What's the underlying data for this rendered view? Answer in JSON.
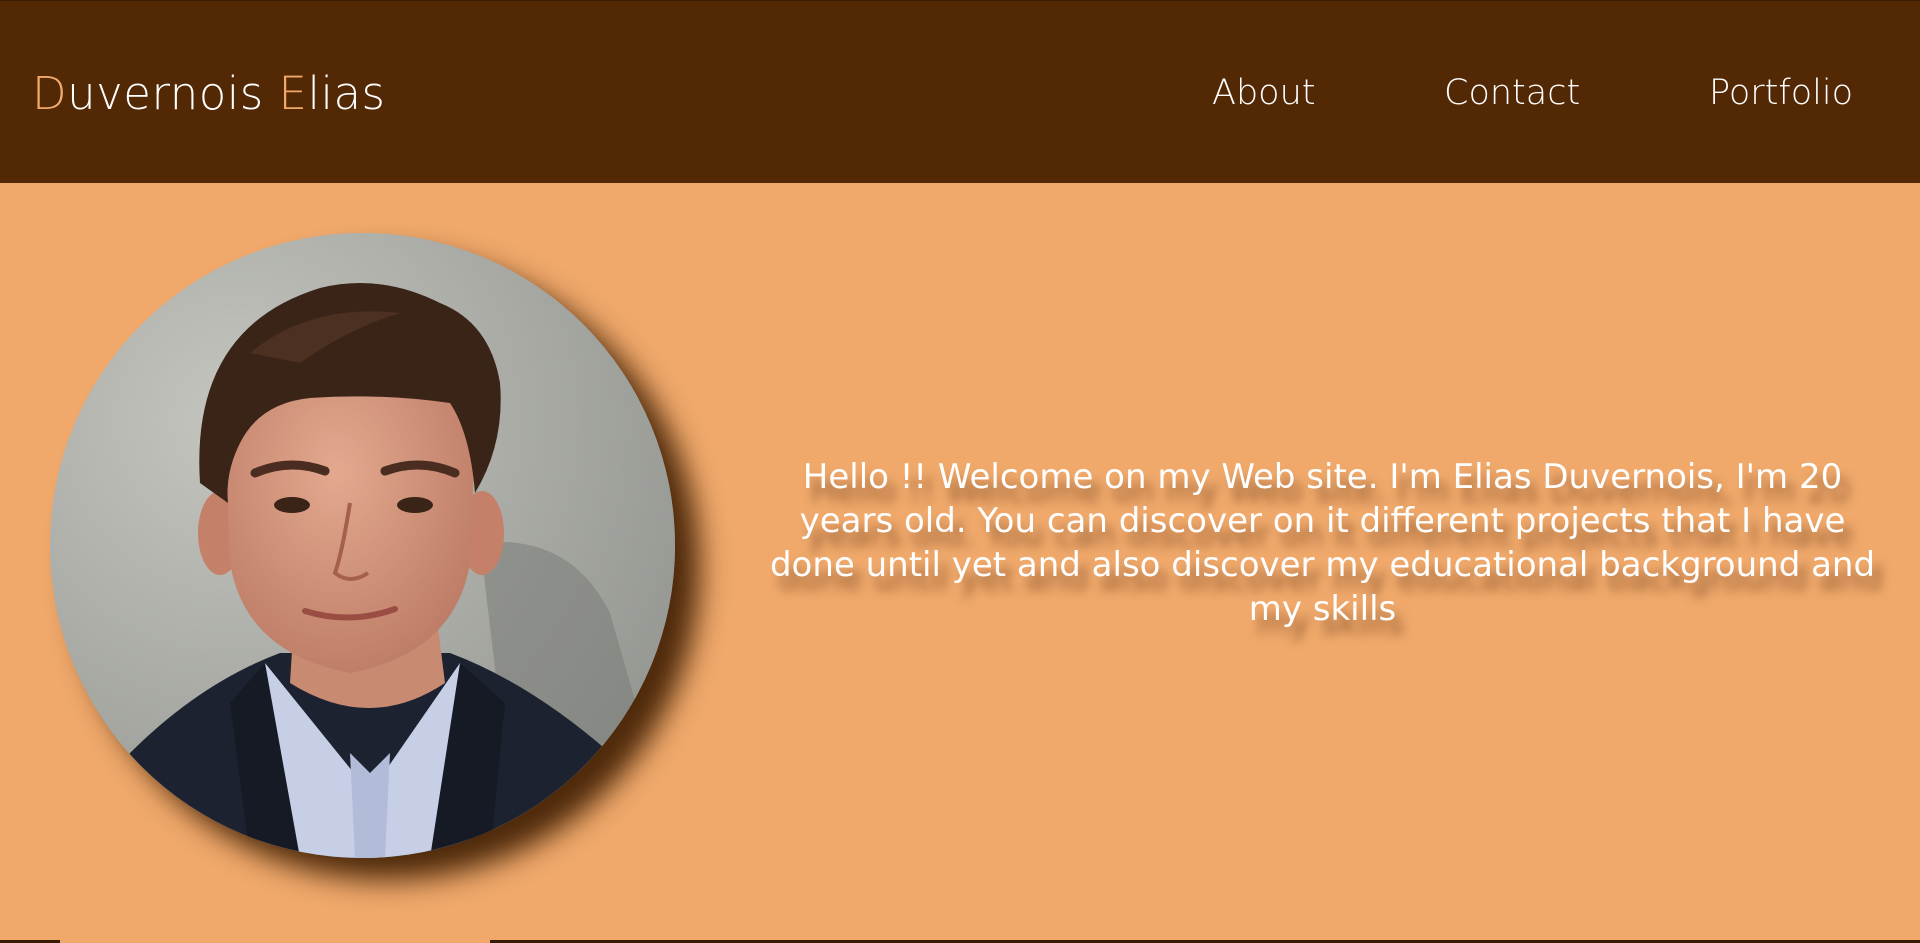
{
  "header": {
    "brand": {
      "first_initial": "D",
      "first_rest": "uvernois ",
      "last_initial": "E",
      "last_rest": "lias"
    },
    "nav": [
      {
        "label": "About"
      },
      {
        "label": "Contact"
      },
      {
        "label": "Portfolio"
      }
    ]
  },
  "hero": {
    "intro": "Hello !! Welcome on my Web site. I'm Elias Duvernois, I'm 20 years old. You can discover on it different projects that I have done until yet and also discover my educational background and my skills"
  },
  "colors": {
    "navbar": "#532805",
    "background": "#f0a96b",
    "accent": "#f0a96b",
    "text": "#ffffff"
  }
}
